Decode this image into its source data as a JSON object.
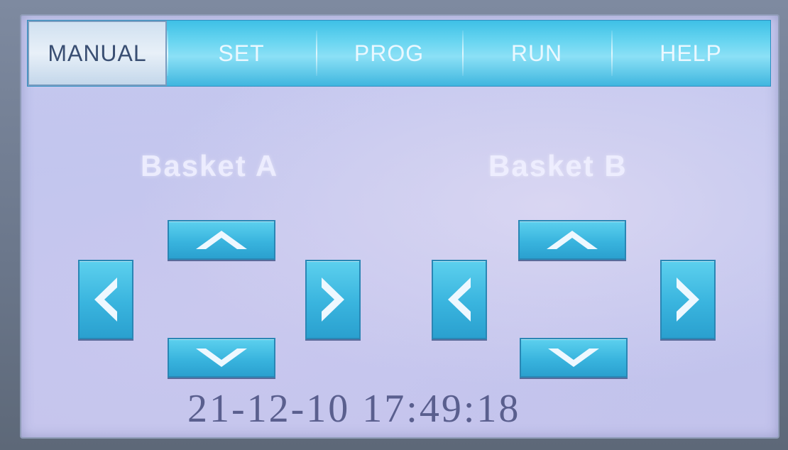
{
  "menu": {
    "tabs": [
      {
        "label": "MANUAL",
        "active": true
      },
      {
        "label": "SET",
        "active": false
      },
      {
        "label": "PROG",
        "active": false
      },
      {
        "label": "RUN",
        "active": false
      },
      {
        "label": "HELP",
        "active": false
      }
    ]
  },
  "baskets": [
    {
      "label": "Basket  A"
    },
    {
      "label": "Basket  B"
    }
  ],
  "icons": {
    "up": "chevron-up-icon",
    "down": "chevron-down-icon",
    "left": "chevron-left-icon",
    "right": "chevron-right-icon"
  },
  "status": {
    "datetime": "21-12-10 17:49:18"
  },
  "colors": {
    "button": "#39b4de",
    "menu": "#66d4f0",
    "active_tab": "#e8f0f8",
    "screen_bg": "#c3c5ee"
  }
}
